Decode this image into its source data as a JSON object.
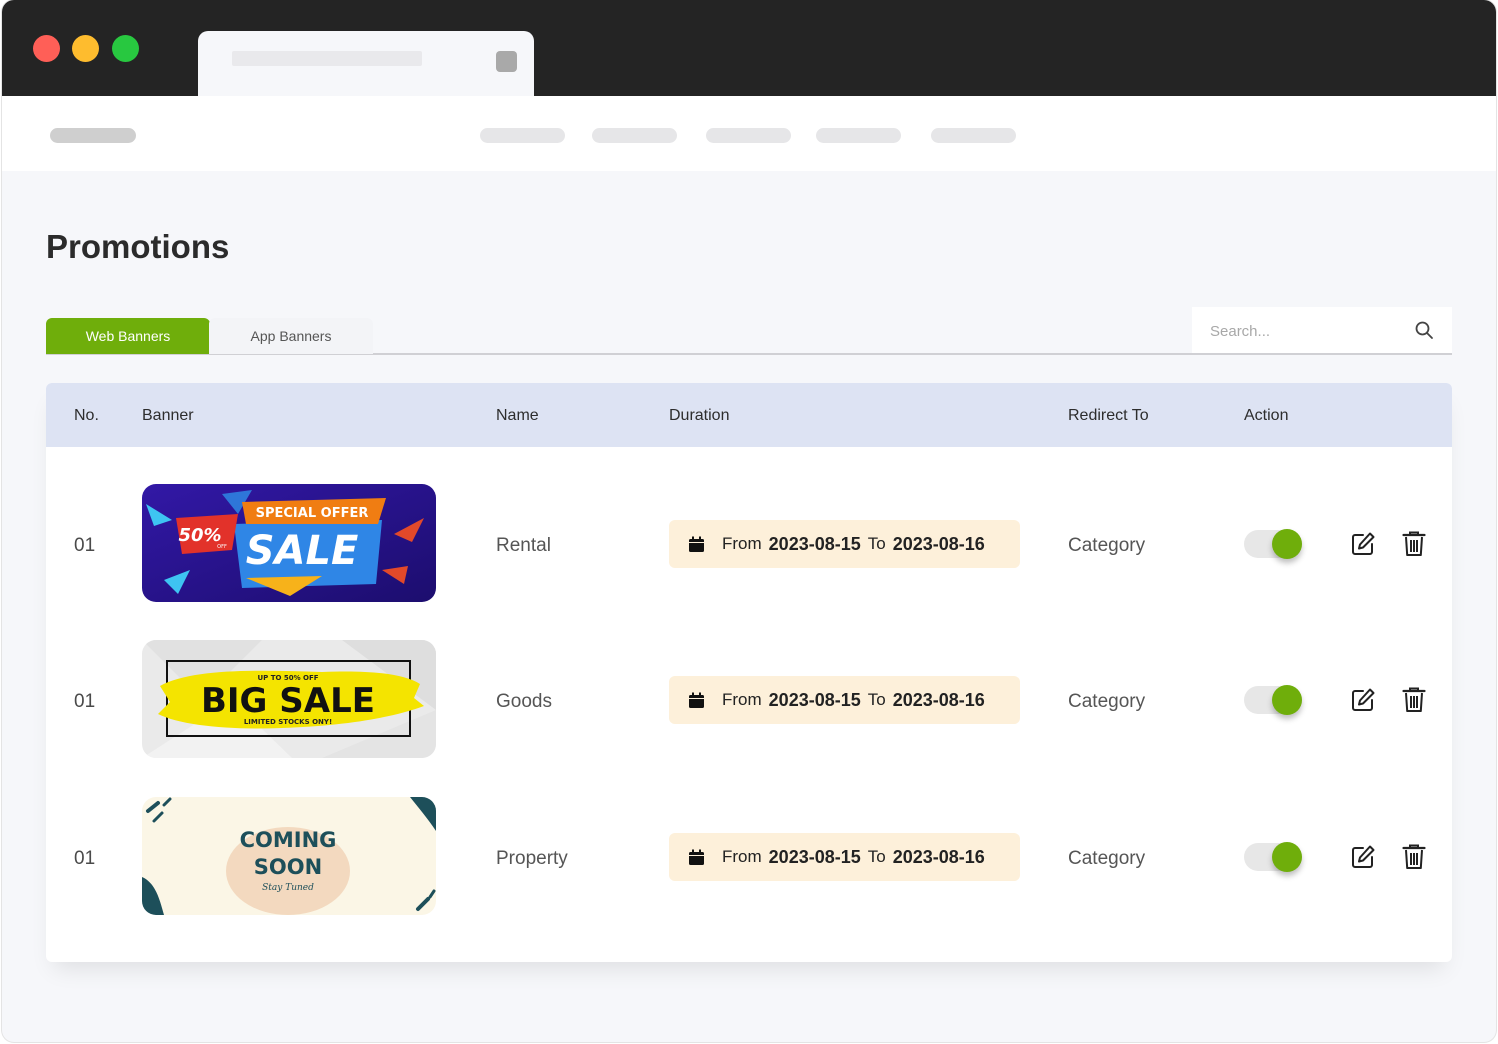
{
  "page": {
    "title": "Promotions"
  },
  "tabs": [
    {
      "label": "Web Banners",
      "active": true
    },
    {
      "label": "App Banners",
      "active": false
    }
  ],
  "search": {
    "placeholder": "Search...",
    "value": ""
  },
  "table": {
    "columns": [
      "No.",
      "Banner",
      "Name",
      "Duration",
      "Redirect To",
      "Action"
    ],
    "rows": [
      {
        "no": "01",
        "banner": {
          "top": "SPECIAL OFFER",
          "badge": "50%",
          "badge_small": "OFF",
          "main": "SALE"
        },
        "name": "Rental",
        "duration": {
          "from_label": "From",
          "from": "2023-08-15",
          "to_label": "To",
          "to": "2023-08-16"
        },
        "redirect": "Category",
        "enabled": true
      },
      {
        "no": "01",
        "banner": {
          "top": "UP TO 50% OFF",
          "main": "BIG SALE",
          "bottom": "LIMITED STOCKS ONY!"
        },
        "name": "Goods",
        "duration": {
          "from_label": "From",
          "from": "2023-08-15",
          "to_label": "To",
          "to": "2023-08-16"
        },
        "redirect": "Category",
        "enabled": true
      },
      {
        "no": "01",
        "banner": {
          "line1": "COMING",
          "line2": "SOON",
          "line3": "Stay Tuned"
        },
        "name": "Property",
        "duration": {
          "from_label": "From",
          "from": "2023-08-15",
          "to_label": "To",
          "to": "2023-08-16"
        },
        "redirect": "Category",
        "enabled": true
      }
    ]
  },
  "colors": {
    "accent": "#6fae0b",
    "header_bg": "#dde3f3",
    "duration_bg": "#fdf0da",
    "titlebar": "#242424"
  },
  "icons": {
    "search": "search-icon",
    "calendar": "calendar-icon",
    "edit": "edit-icon",
    "delete": "trash-icon"
  }
}
